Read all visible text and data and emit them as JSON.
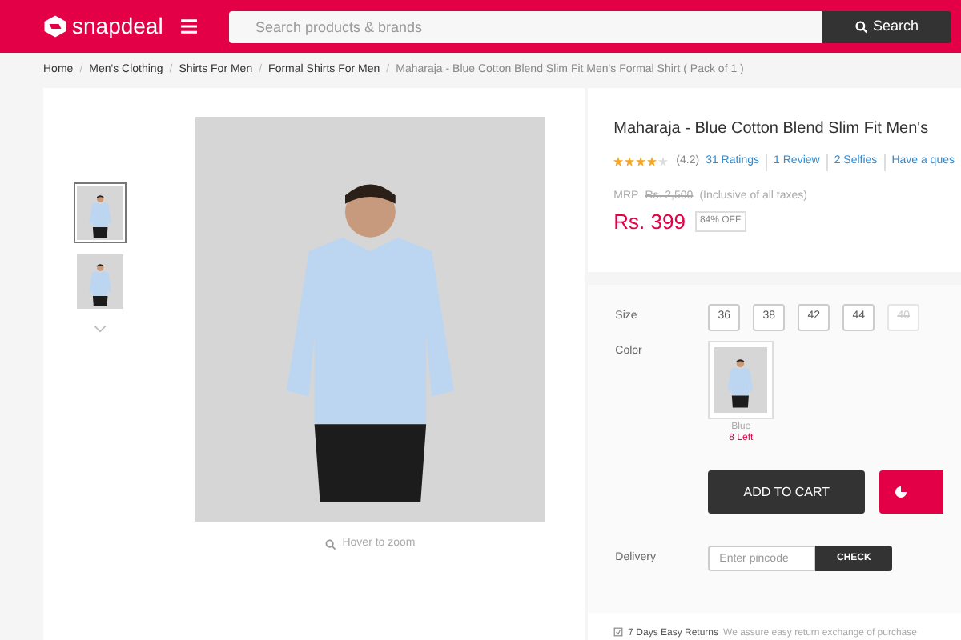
{
  "header": {
    "logo": "snapdeal",
    "search": {
      "placeholder": "Search products & brands",
      "button": "Search"
    }
  },
  "breadcrumb": [
    {
      "label": "Home",
      "current": false
    },
    {
      "separator": "/",
      "label": "Men's Clothing",
      "current": false
    },
    {
      "separator": "/",
      "label": "Shirts For Men",
      "current": false
    },
    {
      "separator": "/",
      "label": "Formal Shirts For Men",
      "current": false
    },
    {
      "separator": "/",
      "label": "Maharaja - Blue Cotton Blend Slim Fit Men's Formal Shirt ( Pack of 1 )",
      "current": true
    }
  ],
  "gallery": {
    "thumbnails": [
      {
        "selected": true
      },
      {
        "selected": false
      }
    ],
    "zoom_hint": "Hover to zoom"
  },
  "product": {
    "title": "Maharaja - Blue Cotton Blend Slim Fit Men's",
    "stars": 4,
    "rating": "(4.2)",
    "links": [
      "31 Ratings",
      "1 Review",
      "2 Selfies",
      "Have a ques"
    ],
    "mrp_label": "MRP",
    "mrp": "Rs. 2,500",
    "tax_note": "(Inclusive of all taxes)",
    "price": "Rs. 399",
    "discount": "84% OFF"
  },
  "options": {
    "size_label": "Size",
    "sizes": [
      {
        "label": "36",
        "available": true
      },
      {
        "label": "38",
        "available": true
      },
      {
        "label": "42",
        "available": true
      },
      {
        "label": "44",
        "available": true
      },
      {
        "label": "40",
        "available": false
      }
    ],
    "color_label": "Color",
    "colors": [
      {
        "name": "Blue",
        "stock": "8 Left",
        "selected": true
      }
    ]
  },
  "actions": {
    "add_to_cart": "ADD TO CART"
  },
  "delivery": {
    "label": "Delivery",
    "placeholder": "Enter pincode",
    "button": "CHECK"
  },
  "returns": {
    "title": "7 Days Easy Returns",
    "text": "We assure easy return exchange of purchase"
  }
}
